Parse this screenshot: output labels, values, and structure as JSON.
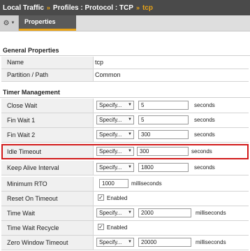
{
  "breadcrumb": {
    "items": [
      "Local Traffic",
      "Profiles : Protocol : TCP",
      "tcp"
    ],
    "separator": "»"
  },
  "tabs": {
    "gear_icon": "gear-icon",
    "properties_label": "Properties"
  },
  "general": {
    "title": "General Properties",
    "name_label": "Name",
    "name_value": "tcp",
    "partition_label": "Partition / Path",
    "partition_value": "Common"
  },
  "timer": {
    "title": "Timer Management",
    "close_wait": {
      "label": "Close Wait",
      "select": "Specify...",
      "value": "5",
      "unit": "seconds"
    },
    "fin_wait_1": {
      "label": "Fin Wait 1",
      "select": "Specify...",
      "value": "5",
      "unit": "seconds"
    },
    "fin_wait_2": {
      "label": "Fin Wait 2",
      "select": "Specify...",
      "value": "300",
      "unit": "seconds"
    },
    "idle_timeout": {
      "label": "Idle Timeout",
      "select": "Specify...",
      "value": "300",
      "unit": "seconds"
    },
    "keep_alive": {
      "label": "Keep Alive Interval",
      "select": "Specify...",
      "value": "1800",
      "unit": "seconds"
    },
    "min_rto": {
      "label": "Minimum RTO",
      "value": "1000",
      "unit": "milliseconds"
    },
    "reset_on_timeout": {
      "label": "Reset On Timeout",
      "checked": true,
      "check_label": "Enabled"
    },
    "time_wait": {
      "label": "Time Wait",
      "select": "Specify...",
      "value": "2000",
      "unit": "milliseconds"
    },
    "time_wait_recycle": {
      "label": "Time Wait Recycle",
      "checked": true,
      "check_label": "Enabled"
    },
    "zero_window": {
      "label": "Zero Window Timeout",
      "select": "Specify...",
      "value": "20000",
      "unit": "milliseconds"
    }
  },
  "colors": {
    "header_bg": "#4a4a4a",
    "accent": "#e8a317",
    "highlight": "#d11a1a"
  }
}
